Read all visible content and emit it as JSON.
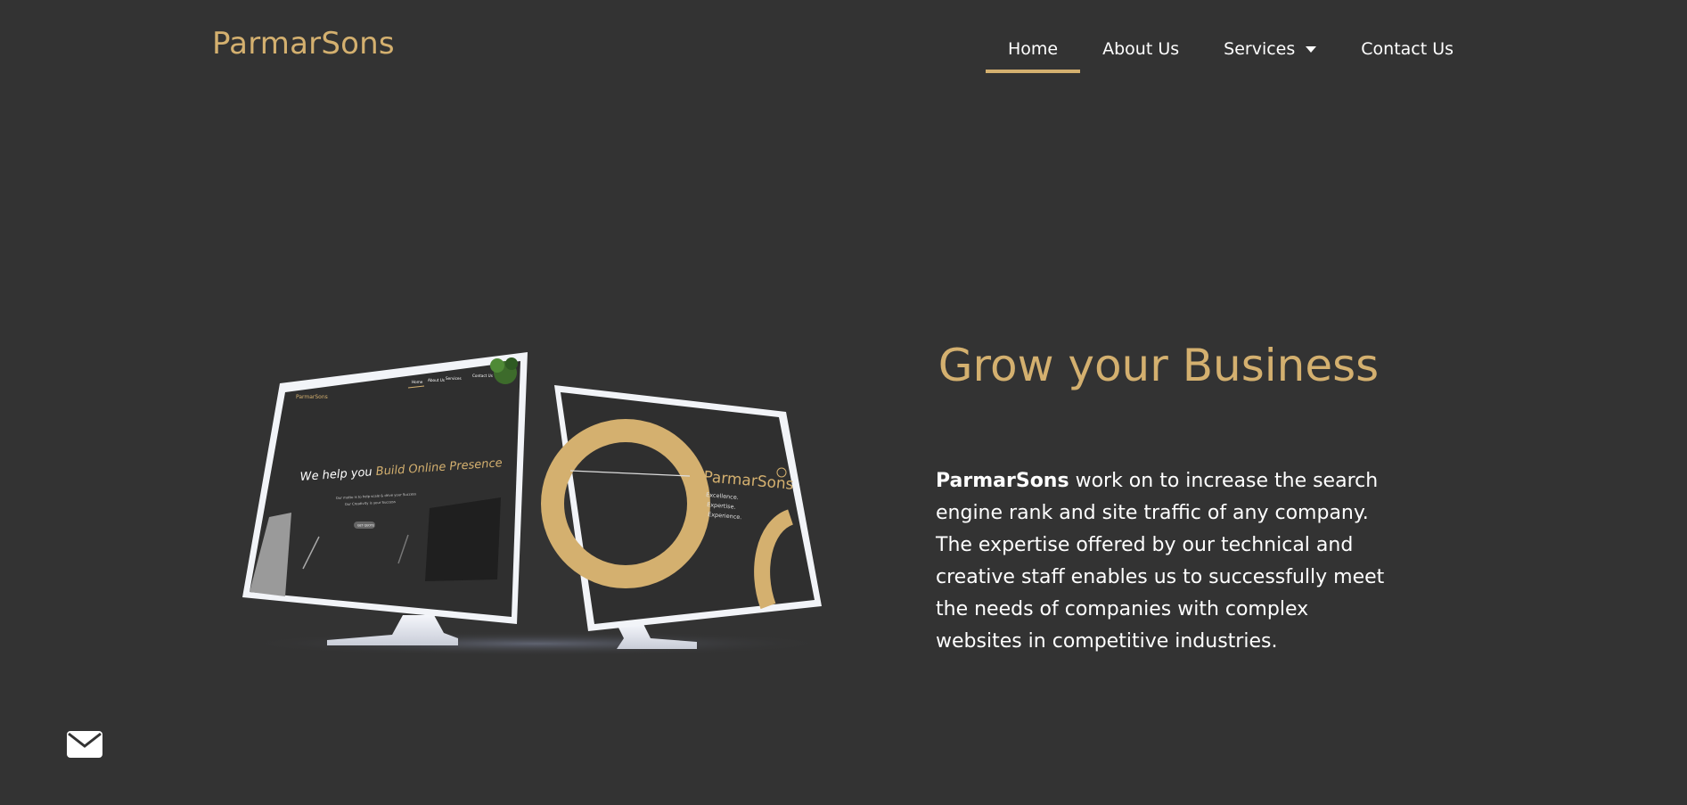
{
  "brand": {
    "name": "ParmarSons",
    "accent_color": "#d4b06f",
    "background_color": "#333333"
  },
  "nav": {
    "items": [
      {
        "label": "Home",
        "active": true
      },
      {
        "label": "About Us",
        "active": false
      },
      {
        "label": "Services",
        "active": false,
        "has_dropdown": true
      },
      {
        "label": "Contact Us",
        "active": false
      }
    ]
  },
  "hero": {
    "title": "Grow your Business",
    "body_bold": "ParmarSons",
    "body_rest": " work on to increase the search engine rank and site traffic of any company. The expertise offered by our technical and creative staff enables us to successfully meet the needs of companies with complex websites in competitive industries."
  },
  "mockup": {
    "left_screen": {
      "logo": "ParmarSons",
      "nav": [
        "Home",
        "About Us",
        "Services",
        "Contact Us"
      ],
      "headline_plain": "We help you ",
      "headline_accent": "Build Online Presence",
      "subline_1": "Our motto is to help scale & drive your Success",
      "subline_2": "Our Creativity is your Success",
      "button": "GET QUOTE"
    },
    "right_screen": {
      "logo": "ParmarSons",
      "tagline_1": "Excellence.",
      "tagline_2": "Expertise.",
      "tagline_3": "Experience."
    }
  },
  "icons": {
    "mail": "envelope-icon",
    "dropdown": "chevron-down-icon"
  }
}
